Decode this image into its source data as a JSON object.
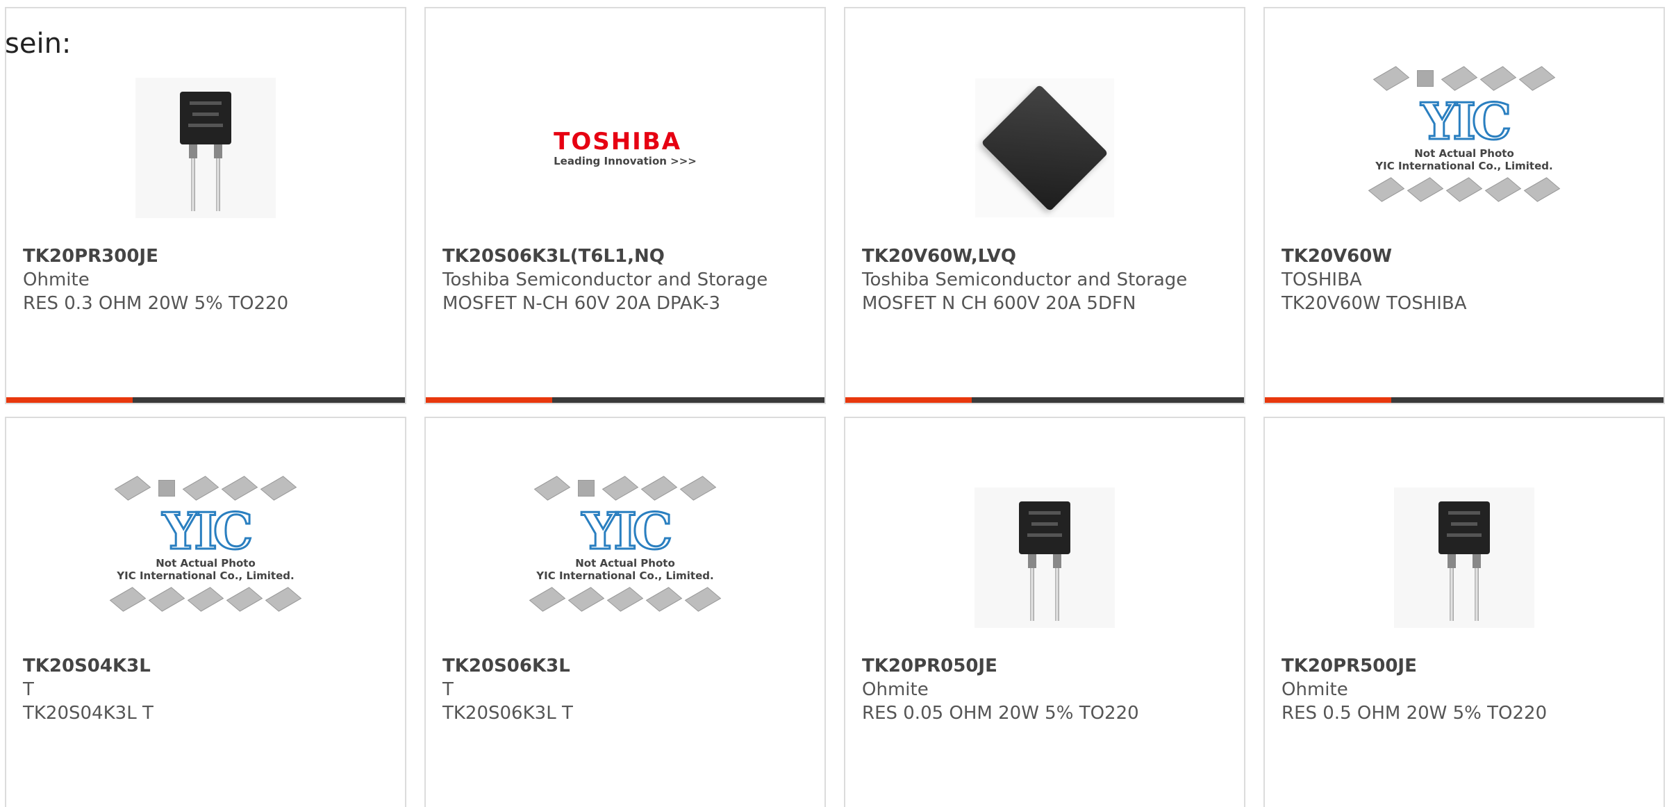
{
  "lead_text": "sein:",
  "placeholder": {
    "logo": "YIC",
    "line1": "Not Actual Photo",
    "line2": "YIC International Co., Limited."
  },
  "toshiba_logo": {
    "name": "TOSHIBA",
    "tagline": "Leading Innovation >>>"
  },
  "colors": {
    "accent": "#e8380d",
    "bar": "#3a3a3a",
    "border": "#dcdcdc",
    "text": "#555555"
  },
  "products": [
    {
      "part": "TK20PR300JE",
      "manufacturer": "Ohmite",
      "description": "RES 0.3 OHM 20W 5% TO220",
      "image": "resistor-photo"
    },
    {
      "part": "TK20S06K3L(T6L1,NQ",
      "manufacturer": "Toshiba Semiconductor and Storage",
      "description": "MOSFET N-CH 60V 20A DPAK-3",
      "image": "toshiba-logo"
    },
    {
      "part": "TK20V60W,LVQ",
      "manufacturer": "Toshiba Semiconductor and Storage",
      "description": "MOSFET N CH 600V 20A 5DFN",
      "image": "chip-photo"
    },
    {
      "part": "TK20V60W",
      "manufacturer": "TOSHIBA",
      "description": "TK20V60W TOSHIBA",
      "image": "placeholder"
    },
    {
      "part": "TK20S04K3L",
      "manufacturer": "T",
      "description": "TK20S04K3L T",
      "image": "placeholder"
    },
    {
      "part": "TK20S06K3L",
      "manufacturer": "T",
      "description": "TK20S06K3L T",
      "image": "placeholder"
    },
    {
      "part": "TK20PR050JE",
      "manufacturer": "Ohmite",
      "description": "RES 0.05 OHM 20W 5% TO220",
      "image": "resistor-photo"
    },
    {
      "part": "TK20PR500JE",
      "manufacturer": "Ohmite",
      "description": "RES 0.5 OHM 20W 5% TO220",
      "image": "resistor-photo"
    }
  ]
}
